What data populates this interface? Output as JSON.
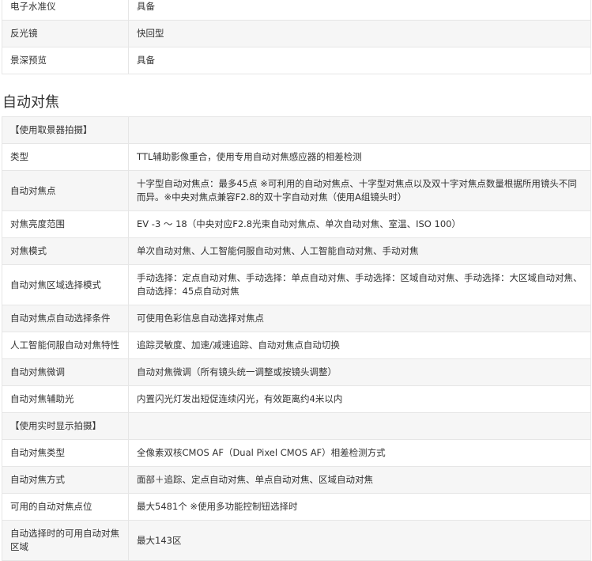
{
  "top_table": {
    "rows": [
      {
        "label": "电子水准仪",
        "value": "具备"
      },
      {
        "label": "反光镜",
        "value": "快回型"
      },
      {
        "label": "景深预览",
        "value": "具备"
      }
    ]
  },
  "section": {
    "title": "自动对焦"
  },
  "af_table": {
    "rows": [
      {
        "label": "【使用取景器拍摄】",
        "value": ""
      },
      {
        "label": "类型",
        "value": "TTL辅助影像重合，使用专用自动对焦感应器的相差检测"
      },
      {
        "label": "自动对焦点",
        "value": "十字型自动对焦点：最多45点 ※可利用的自动对焦点、十字型对焦点以及双十字对焦点数量根据所用镜头不同而异。※中央对焦点兼容F2.8的双十字自动对焦（使用A组镜头时）"
      },
      {
        "label": "对焦亮度范围",
        "value": "EV -3 ～ 18（中央对应F2.8光束自动对焦点、单次自动对焦、室温、ISO 100）"
      },
      {
        "label": "对焦模式",
        "value": "单次自动对焦、人工智能伺服自动对焦、人工智能自动对焦、手动对焦"
      },
      {
        "label": "自动对焦区域选择模式",
        "value": "手动选择：定点自动对焦、手动选择：单点自动对焦、手动选择：区域自动对焦、手动选择：大区域自动对焦、自动选择：45点自动对焦"
      },
      {
        "label": "自动对焦点自动选择条件",
        "value": "可使用色彩信息自动选择对焦点"
      },
      {
        "label": "人工智能伺服自动对焦特性",
        "value": "追踪灵敏度、加速/减速追踪、自动对焦点自动切换"
      },
      {
        "label": "自动对焦微调",
        "value": "自动对焦微调（所有镜头统一调整或按镜头调整）"
      },
      {
        "label": "自动对焦辅助光",
        "value": "内置闪光灯发出短促连续闪光，有效距离约4米以内"
      },
      {
        "label": "【使用实时显示拍摄】",
        "value": ""
      },
      {
        "label": "自动对焦类型",
        "value": "全像素双核CMOS AF（Dual Pixel CMOS AF）相差检测方式"
      },
      {
        "label": "自动对焦方式",
        "value": "面部＋追踪、定点自动对焦、单点自动对焦、区域自动对焦"
      },
      {
        "label": "可用的自动对焦点位",
        "value": "最大5481个 ※使用多功能控制钮选择时"
      },
      {
        "label": "自动选择时的可用自动对焦区域",
        "value": "最大143区"
      }
    ]
  }
}
